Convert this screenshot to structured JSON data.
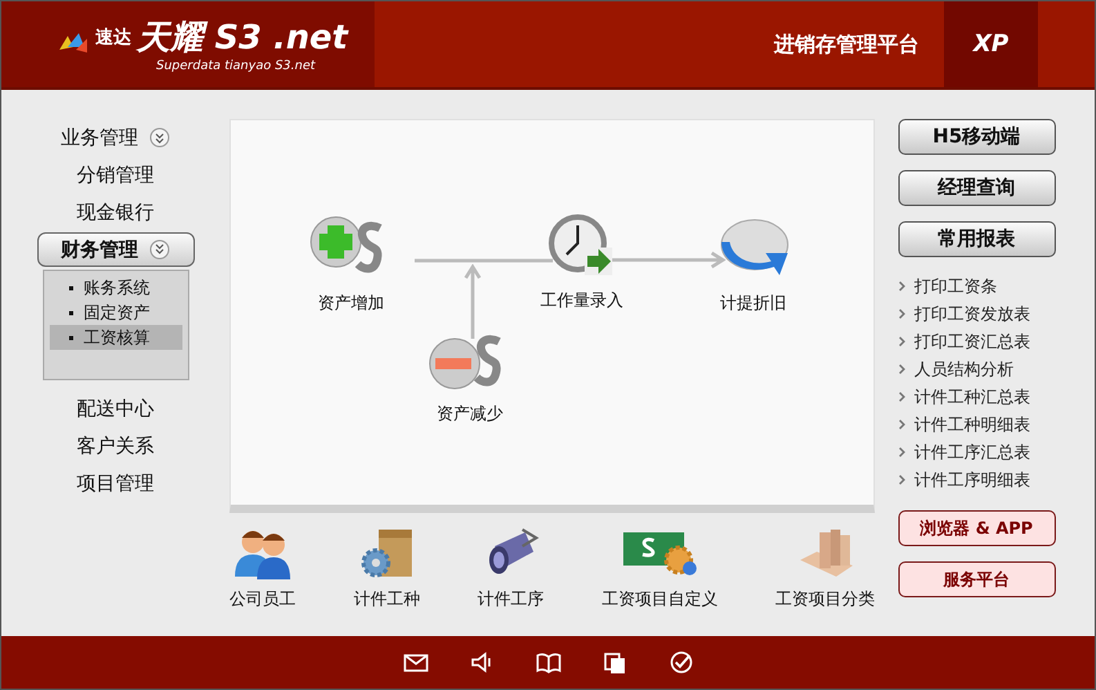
{
  "header": {
    "logo_mark": "速达",
    "logo_title": "天耀 S3 .net",
    "logo_subtitle": "Superdata tianyao S3.net",
    "platform": "进销存管理平台",
    "edition": "XP"
  },
  "sidebar": {
    "items": [
      {
        "label": "业务管理",
        "selected": false,
        "expanded": false
      },
      {
        "label": "分销管理",
        "selected": false
      },
      {
        "label": "现金银行",
        "selected": false
      },
      {
        "label": "财务管理",
        "selected": true,
        "expanded": true,
        "children": [
          {
            "label": "账务系统",
            "selected": false
          },
          {
            "label": "固定资产",
            "selected": false
          },
          {
            "label": "工资核算",
            "selected": true
          }
        ]
      },
      {
        "label": "配送中心",
        "selected": false
      },
      {
        "label": "客户关系",
        "selected": false
      },
      {
        "label": "项目管理",
        "selected": false
      }
    ]
  },
  "flow": {
    "nodes": [
      {
        "label": "资产增加",
        "kind": "add"
      },
      {
        "label": "资产减少",
        "kind": "remove"
      },
      {
        "label": "工作量录入",
        "kind": "clock"
      },
      {
        "label": "计提折旧",
        "kind": "refresh"
      }
    ]
  },
  "shortcuts": [
    {
      "label": "公司员工",
      "kind": "people"
    },
    {
      "label": "计件工种",
      "kind": "box"
    },
    {
      "label": "计件工序",
      "kind": "pipe"
    },
    {
      "label": "工资项目自定义",
      "kind": "money"
    },
    {
      "label": "工资项目分类",
      "kind": "books"
    }
  ],
  "right_panel": {
    "buttons": [
      "H5移动端",
      "经理查询",
      "常用报表"
    ],
    "reports": [
      "打印工资条",
      "打印工资发放表",
      "打印工资汇总表",
      "人员结构分析",
      "计件工种汇总表",
      "计件工种明细表",
      "计件工序汇总表",
      "计件工序明细表"
    ],
    "service_buttons": [
      "浏览器 & APP",
      "服务平台"
    ]
  }
}
